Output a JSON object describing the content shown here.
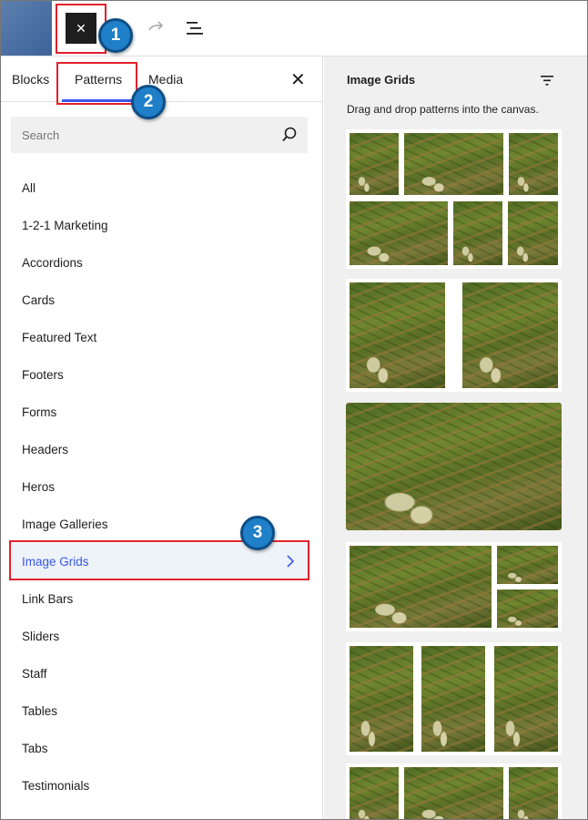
{
  "toolbar": {
    "close_icon": "✕",
    "redo_icon": "redo-icon",
    "document_overview_icon": "list-view-icon"
  },
  "callouts": [
    "1",
    "2",
    "3"
  ],
  "inserter": {
    "tabs": [
      {
        "label": "Blocks"
      },
      {
        "label": "Patterns"
      },
      {
        "label": "Media"
      }
    ],
    "active_tab": "Patterns",
    "close_icon": "✕",
    "search_placeholder": "Search",
    "categories": [
      {
        "label": "All"
      },
      {
        "label": "1-2-1 Marketing"
      },
      {
        "label": "Accordions"
      },
      {
        "label": "Cards"
      },
      {
        "label": "Featured Text"
      },
      {
        "label": "Footers"
      },
      {
        "label": "Forms"
      },
      {
        "label": "Headers"
      },
      {
        "label": "Heros"
      },
      {
        "label": "Image Galleries"
      },
      {
        "label": "Image Grids"
      },
      {
        "label": "Link Bars"
      },
      {
        "label": "Sliders"
      },
      {
        "label": "Staff"
      },
      {
        "label": "Tables"
      },
      {
        "label": "Tabs"
      },
      {
        "label": "Testimonials"
      }
    ],
    "selected_category": "Image Grids"
  },
  "preview": {
    "title": "Image Grids",
    "description": "Drag and drop patterns into the canvas."
  },
  "colors": {
    "accent": "#3858e9",
    "callout_blue": "#1f7fc8",
    "highlight_red": "#e0202a"
  }
}
